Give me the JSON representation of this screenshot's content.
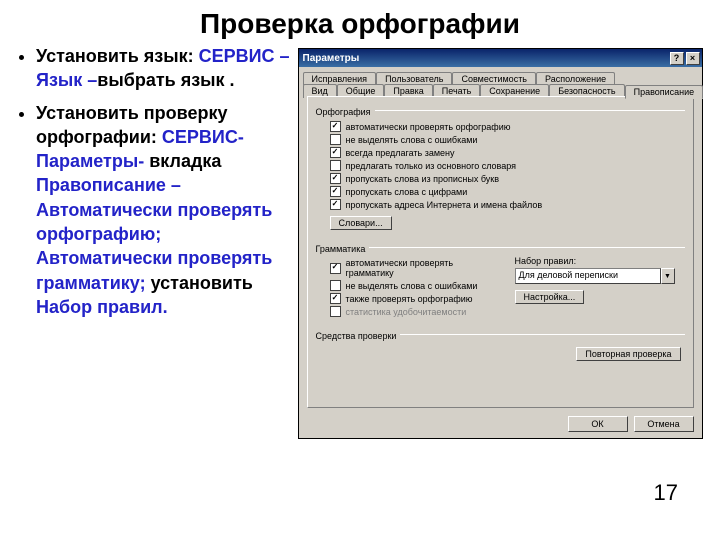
{
  "slide": {
    "title": "Проверка орфографии",
    "pagenum": "17",
    "bullet1": {
      "prefix": "Установить язык: ",
      "menu": "СЕРВИС – Язык –",
      "suffix": "выбрать язык ."
    },
    "bullet2": {
      "prefix": "Установить проверку орфографии: ",
      "menu1": "СЕРВИС-Параметры-",
      "mid1": " вкладка ",
      "menu2": "Правописание – Автоматически проверять орфографию; Автоматически проверять грамматику;",
      "mid2": " установить ",
      "menu3": "Набор правил."
    }
  },
  "dialog": {
    "title": "Параметры",
    "help_btn": "?",
    "close_btn": "×",
    "tabs_row1": [
      "Исправления",
      "Пользователь",
      "Совместимость",
      "Расположение"
    ],
    "tabs_row2": [
      "Вид",
      "Общие",
      "Правка",
      "Печать",
      "Сохранение",
      "Безопасность",
      "Правописание"
    ],
    "spelling": {
      "group": "Орфография",
      "opts": [
        {
          "label": "автоматически проверять орфографию",
          "checked": true
        },
        {
          "label": "не выделять слова с ошибками",
          "checked": false
        },
        {
          "label": "всегда предлагать замену",
          "checked": true
        },
        {
          "label": "предлагать только из основного словаря",
          "checked": false
        },
        {
          "label": "пропускать слова из прописных букв",
          "checked": true
        },
        {
          "label": "пропускать слова с цифрами",
          "checked": true
        },
        {
          "label": "пропускать адреса Интернета и имена файлов",
          "checked": true
        }
      ],
      "dict_btn": "Словари..."
    },
    "grammar": {
      "group": "Грамматика",
      "opts": [
        {
          "label": "автоматически проверять грамматику",
          "checked": true
        },
        {
          "label": "не выделять слова с ошибками",
          "checked": false
        },
        {
          "label": "также проверять орфографию",
          "checked": true
        },
        {
          "label": "статистика удобочитаемости",
          "checked": false
        }
      ],
      "ruleset_label": "Набор правил:",
      "ruleset_value": "Для деловой переписки",
      "settings_btn": "Настройка..."
    },
    "tools": {
      "group": "Средства проверки",
      "recheck_btn": "Повторная проверка"
    },
    "ok": "ОК",
    "cancel": "Отмена"
  }
}
